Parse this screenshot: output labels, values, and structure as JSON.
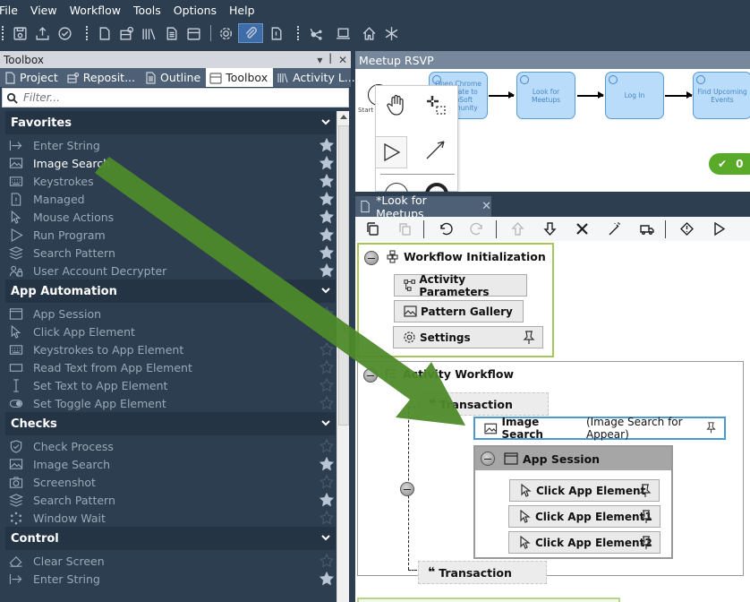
{
  "menu": [
    "File",
    "View",
    "Workflow",
    "Tools",
    "Options",
    "Help"
  ],
  "toolbar": {
    "icons": [
      "save-icon",
      "publish-icon",
      "validate-icon",
      "new-file-icon",
      "repository-icon",
      "library-icon",
      "document-icon",
      "package-icon",
      "settings-icon",
      "attach-icon",
      "info-file-icon",
      "network-icon",
      "laptop-icon",
      "home-icon",
      "asterisk-icon"
    ],
    "active": "attach-icon"
  },
  "left_panel": {
    "title": "Toolbox",
    "controls": [
      "▾",
      "📌",
      "✕"
    ],
    "tabs": [
      {
        "label": "Project",
        "active": false
      },
      {
        "label": "Reposit...",
        "active": false
      },
      {
        "label": "Outline",
        "active": false
      },
      {
        "label": "Toolbox",
        "active": true
      },
      {
        "label": "Activity L...",
        "active": false
      }
    ],
    "filter_placeholder": "Filter..."
  },
  "toolbox": {
    "sections": [
      {
        "title": "Favorites",
        "items": [
          {
            "label": "Enter String",
            "icon": "enter-string-icon",
            "starred": true
          },
          {
            "label": "Image Search",
            "icon": "image-icon",
            "starred": true,
            "highlight": true
          },
          {
            "label": "Keystrokes",
            "icon": "keyboard-icon",
            "starred": true
          },
          {
            "label": "Managed",
            "icon": "managed-icon",
            "starred": true
          },
          {
            "label": "Mouse Actions",
            "icon": "cursor-icon",
            "starred": true
          },
          {
            "label": "Run Program",
            "icon": "play-icon",
            "starred": true
          },
          {
            "label": "Search Pattern",
            "icon": "layers-icon",
            "starred": true
          },
          {
            "label": "User Account Decrypter",
            "icon": "users-icon",
            "starred": true
          }
        ]
      },
      {
        "title": "App Automation",
        "items": [
          {
            "label": "App Session",
            "icon": "window-icon",
            "starred": false
          },
          {
            "label": "Click App Element",
            "icon": "cursor-icon",
            "starred": false
          },
          {
            "label": "Keystrokes to App Element",
            "icon": "keyboard-icon",
            "starred": false
          },
          {
            "label": "Read Text from App Element",
            "icon": "textbox-icon",
            "starred": false
          },
          {
            "label": "Set Text to App Element",
            "icon": "text-cursor-icon",
            "starred": false
          },
          {
            "label": "Set Toggle App Element",
            "icon": "toggle-icon",
            "starred": false
          }
        ]
      },
      {
        "title": "Checks",
        "items": [
          {
            "label": "Check Process",
            "icon": "shield-check-icon",
            "starred": false
          },
          {
            "label": "Image Search",
            "icon": "image-icon",
            "starred": true
          },
          {
            "label": "Screenshot",
            "icon": "camera-icon",
            "starred": false
          },
          {
            "label": "Search Pattern",
            "icon": "layers-icon",
            "starred": true
          },
          {
            "label": "Window Wait",
            "icon": "spinner-icon",
            "starred": false
          }
        ]
      },
      {
        "title": "Control",
        "items": [
          {
            "label": "Clear Screen",
            "icon": "eraser-icon",
            "starred": false
          },
          {
            "label": "Enter String",
            "icon": "enter-string-icon",
            "starred": true
          }
        ]
      }
    ]
  },
  "rsvp": {
    "title": "Meetup RSVP",
    "start_label": "Start",
    "nodes": [
      "Open Chrome Navigate to AutoSoft Community",
      "Look for Meetups",
      "Log In",
      "Find Upcoming Events"
    ],
    "status_count": "0"
  },
  "editor": {
    "tab_title": "*Look for Meetups",
    "workflow_init": {
      "title": "Workflow Initialization",
      "items": [
        "Activity Parameters",
        "Pattern Gallery",
        "Settings"
      ]
    },
    "activity_workflow": {
      "title": "Activity Workflow",
      "transaction_top": "Transaction",
      "image_search_name": "Image Search",
      "image_search_desc": "(Image Search for Appear)",
      "app_session": {
        "title": "App Session",
        "items": [
          "Click App Element",
          "Click App Element1",
          "Click App Element2"
        ]
      },
      "transaction_bottom": "Transaction"
    }
  },
  "colors": {
    "chrome_bg": "#2d3e50",
    "accent_green": "#5aaa2a",
    "arrow_green": "#4e8a2a",
    "node_blue": "#b8dcfa",
    "selected_border": "#4a9ad0"
  }
}
